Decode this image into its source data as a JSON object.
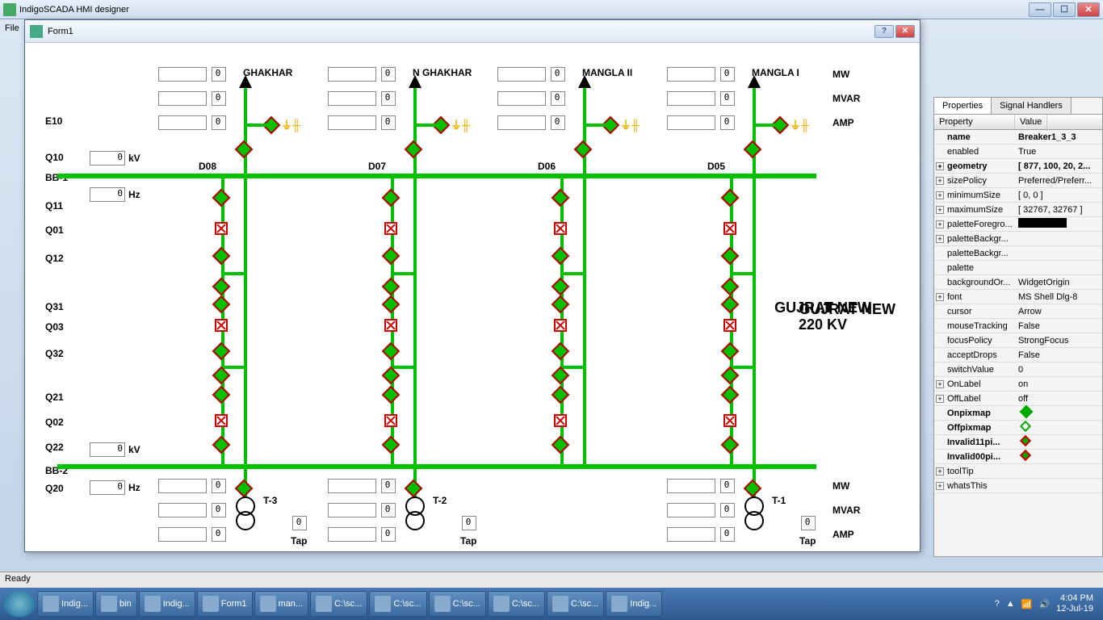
{
  "app_title": "IndigoSCADA HMI designer",
  "menu": [
    "File"
  ],
  "form_title": "Form1",
  "feeders": [
    {
      "name": "GHAKHAR",
      "bay": "D08"
    },
    {
      "name": "N GHAKHAR",
      "bay": "D07"
    },
    {
      "name": "MANGLA II",
      "bay": "D06"
    },
    {
      "name": "MANGLA I",
      "bay": "D05"
    }
  ],
  "transformers": [
    {
      "name": "T-3",
      "tap": "Tap"
    },
    {
      "name": "T-2",
      "tap": "Tap"
    },
    {
      "name": "T-1",
      "tap": "Tap"
    }
  ],
  "rowlabels": [
    "E10",
    "Q10",
    "BB-1",
    "Q11",
    "Q01",
    "Q12",
    "Q31",
    "Q03",
    "Q32",
    "Q21",
    "Q02",
    "Q22",
    "BB-2",
    "Q20"
  ],
  "units": {
    "mw": "MW",
    "mvar": "MVAR",
    "amp": "AMP",
    "kv": "kV",
    "hz": "Hz"
  },
  "station": {
    "name": "GUJRAT NEW",
    "volt": "220 KV"
  },
  "status": "Ready",
  "prop_tabs": {
    "p": "Properties",
    "s": "Signal Handlers"
  },
  "prop_head": {
    "p": "Property",
    "v": "Value"
  },
  "props": [
    {
      "n": "name",
      "v": "Breaker1_3_3",
      "b": 1
    },
    {
      "n": "enabled",
      "v": "True"
    },
    {
      "n": "geometry",
      "v": "[ 877, 100, 20, 2...",
      "b": 1,
      "e": 1
    },
    {
      "n": "sizePolicy",
      "v": "Preferred/Preferr...",
      "e": 1
    },
    {
      "n": "minimumSize",
      "v": "[ 0, 0 ]",
      "e": 1
    },
    {
      "n": "maximumSize",
      "v": "[ 32767, 32767 ]",
      "e": 1
    },
    {
      "n": "paletteForegro...",
      "v": "[color]",
      "e": 1
    },
    {
      "n": "paletteBackgr...",
      "v": "",
      "e": 1
    },
    {
      "n": "paletteBackgr...",
      "v": ""
    },
    {
      "n": "palette",
      "v": ""
    },
    {
      "n": "backgroundOr...",
      "v": "WidgetOrigin"
    },
    {
      "n": "font",
      "v": "MS Shell Dlg-8",
      "e": 1
    },
    {
      "n": "cursor",
      "v": "Arrow"
    },
    {
      "n": "mouseTracking",
      "v": "False"
    },
    {
      "n": "focusPolicy",
      "v": "StrongFocus"
    },
    {
      "n": "acceptDrops",
      "v": "False"
    },
    {
      "n": "switchValue",
      "v": "0"
    },
    {
      "n": "OnLabel",
      "v": "on",
      "e": 1
    },
    {
      "n": "OffLabel",
      "v": "off",
      "e": 1
    },
    {
      "n": "Onpixmap",
      "v": "[dg]",
      "b": 1
    },
    {
      "n": "Offpixmap",
      "v": "[dgo]",
      "b": 1
    },
    {
      "n": "Invalid11pi...",
      "v": "[dro]",
      "b": 1
    },
    {
      "n": "Invalid00pi...",
      "v": "[dro]",
      "b": 1
    },
    {
      "n": "toolTip",
      "v": "",
      "e": 1
    },
    {
      "n": "whatsThis",
      "v": "",
      "e": 1
    }
  ],
  "taskbar": [
    "Indig...",
    "bin",
    "Indig...",
    "Form1",
    "man...",
    "C:\\sc...",
    "C:\\sc...",
    "C:\\sc...",
    "C:\\sc...",
    "C:\\sc...",
    "Indig..."
  ],
  "time": "4:04 PM",
  "date": "12-Jul-19"
}
